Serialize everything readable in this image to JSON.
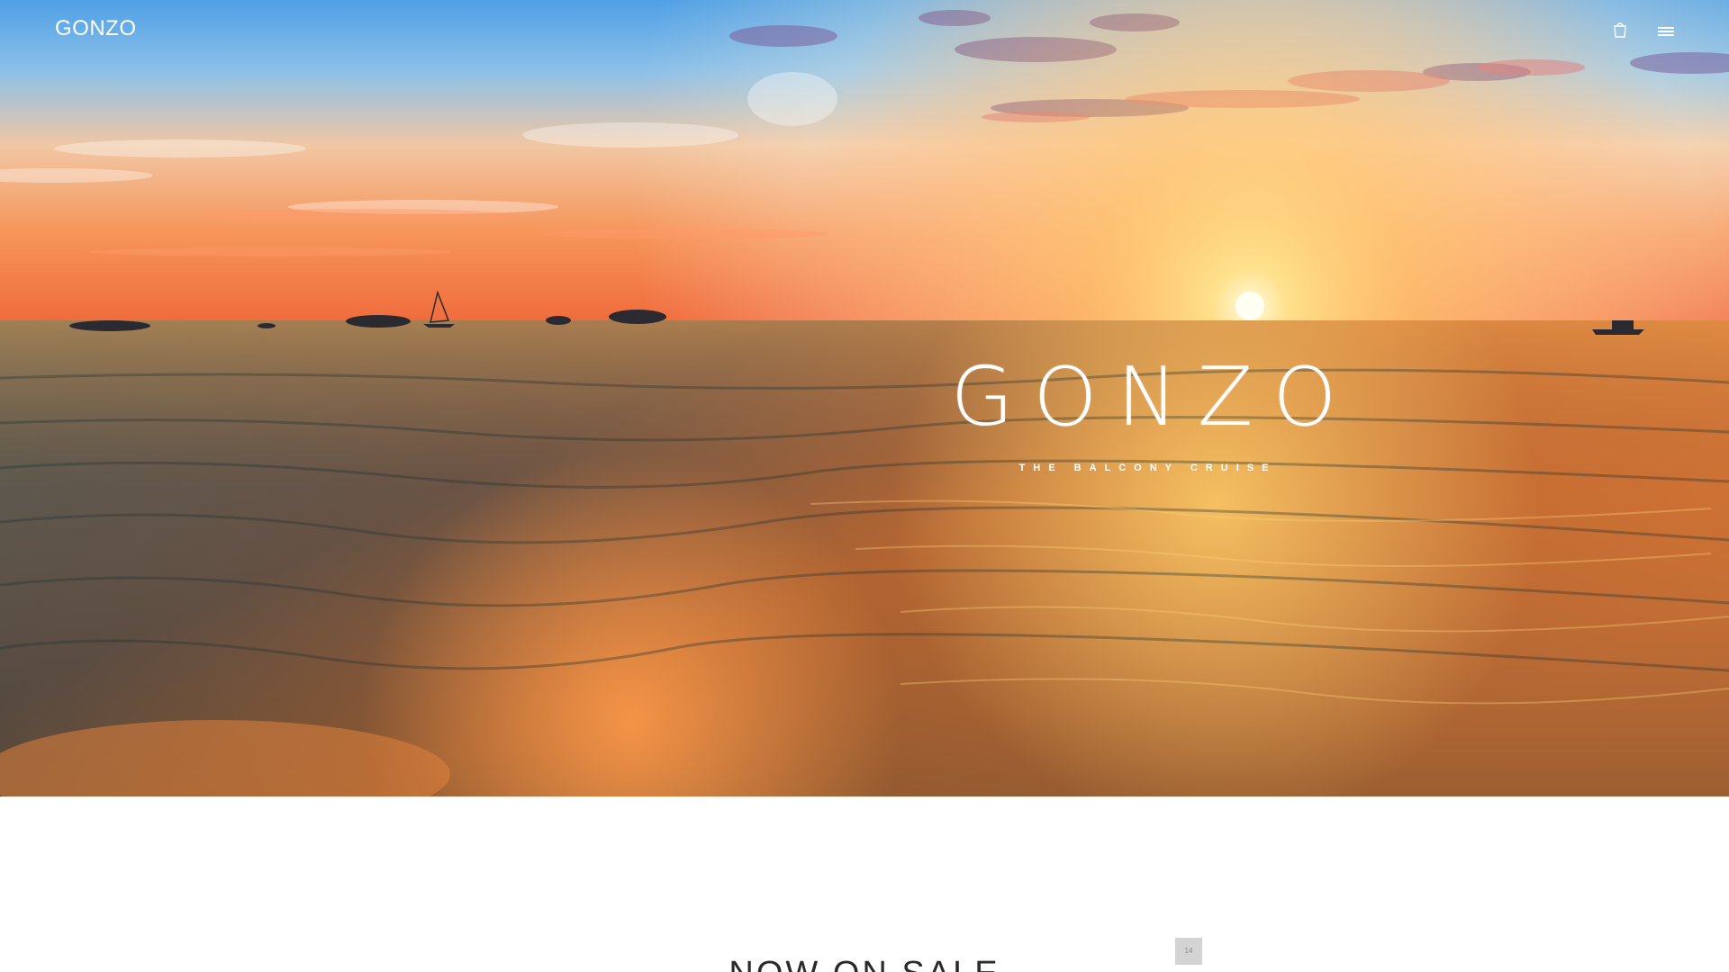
{
  "header": {
    "logo": "GONZO",
    "cart_icon": "shopping-bag-icon",
    "menu_icon": "hamburger-menu-icon"
  },
  "hero": {
    "title": "GONZO",
    "subtitle": "THE BALCONY CRUISE",
    "background": "sunset-over-sea-photo"
  },
  "sale": {
    "heading": "NOW ON SALE",
    "scroll_badge": "14"
  },
  "colors": {
    "header_text": "#ffffff",
    "heading_text": "#2a2a2a",
    "badge_bg": "#d3d3d3"
  }
}
